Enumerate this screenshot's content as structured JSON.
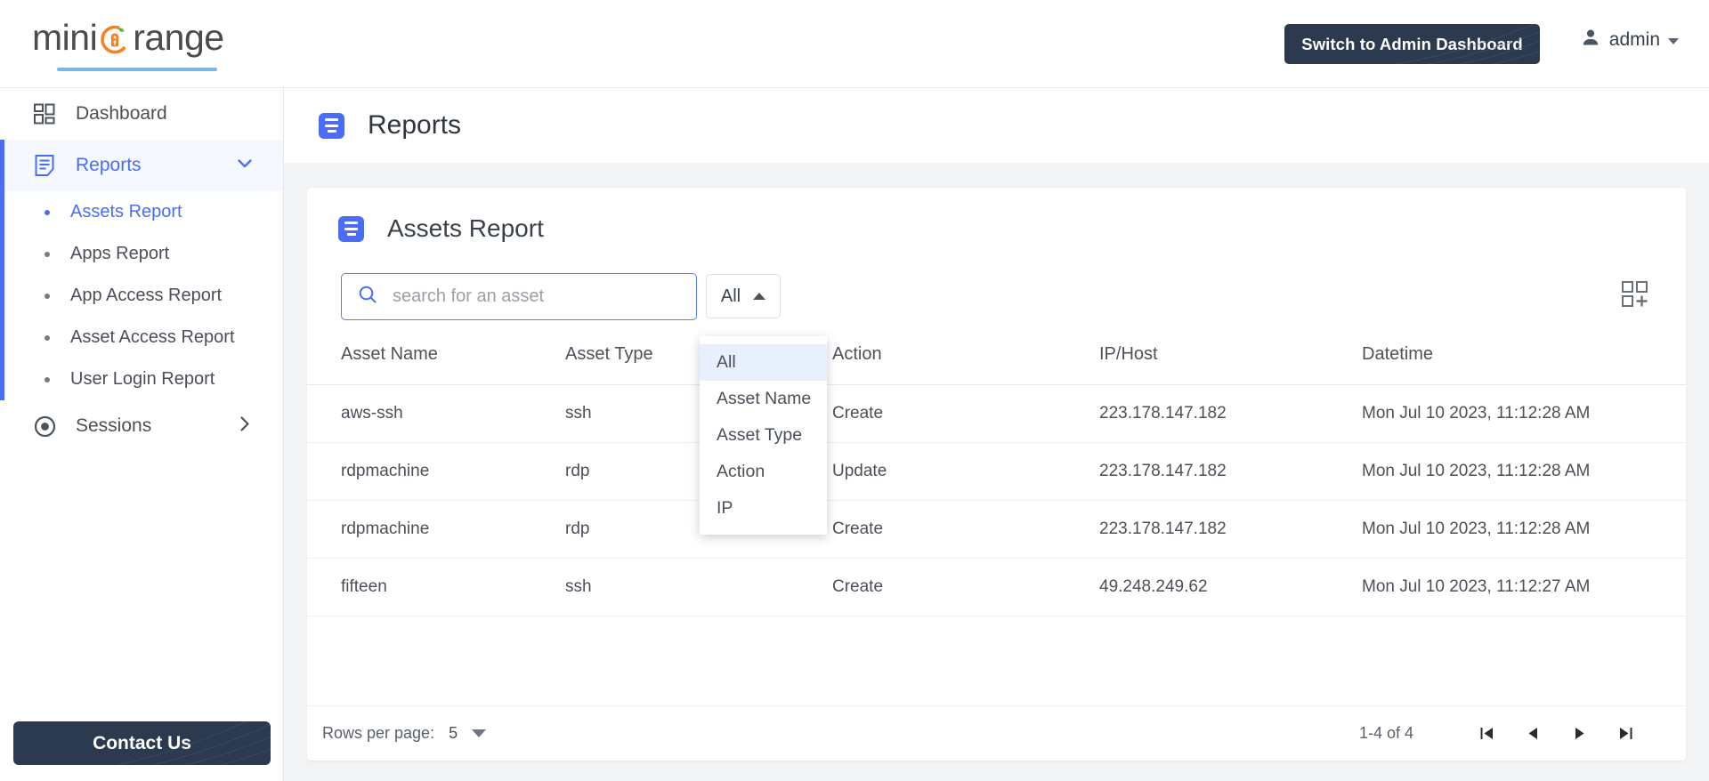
{
  "brand": {
    "logo_prefix": "mini",
    "logo_suffix": "range",
    "logo_icon": "orange-lock-icon"
  },
  "topbar": {
    "switch_admin_label": "Switch to Admin Dashboard",
    "user_name": "admin",
    "user_icon": "person-icon",
    "user_caret_icon": "chevron-down-icon"
  },
  "sidebar": {
    "items": [
      {
        "label": "Dashboard",
        "icon": "grid-dashboard-icon",
        "active": false,
        "expandable": false
      },
      {
        "label": "Reports",
        "icon": "document-lines-icon",
        "active": true,
        "expandable": true,
        "chevron": "chevron-down-icon"
      },
      {
        "label": "Sessions",
        "icon": "record-circle-icon",
        "active": false,
        "expandable": true,
        "chevron": "chevron-right-icon"
      }
    ],
    "sub_items": [
      {
        "label": "Assets Report",
        "selected": true
      },
      {
        "label": "Apps Report",
        "selected": false
      },
      {
        "label": "App Access Report",
        "selected": false
      },
      {
        "label": "Asset Access Report",
        "selected": false
      },
      {
        "label": "User Login Report",
        "selected": false
      }
    ],
    "contact_us_label": "Contact Us"
  },
  "page": {
    "title": "Reports",
    "title_icon": "document-lines-icon"
  },
  "card": {
    "title": "Assets Report",
    "title_icon": "document-lines-icon"
  },
  "toolbar": {
    "search_placeholder": "search for an asset",
    "search_value": "",
    "search_icon": "search-icon",
    "filter_label": "All",
    "filter_caret_icon": "chevron-up-icon",
    "grid_add_icon": "add-column-grid-icon"
  },
  "filter_dropdown": {
    "open": true,
    "selected": "All",
    "options": [
      {
        "label": "All",
        "active": true
      },
      {
        "label": "Asset Name",
        "active": false
      },
      {
        "label": "Asset Type",
        "active": false
      },
      {
        "label": "Action",
        "active": false
      },
      {
        "label": "IP",
        "active": false
      }
    ]
  },
  "table": {
    "columns": [
      "Asset Name",
      "Asset Type",
      "Action",
      "IP/Host",
      "Datetime"
    ],
    "rows": [
      {
        "asset_name": "aws-ssh",
        "asset_type": "ssh",
        "action": "Create",
        "ip_host": "223.178.147.182",
        "datetime": "Mon Jul 10 2023, 11:12:28 AM"
      },
      {
        "asset_name": "rdpmachine",
        "asset_type": "rdp",
        "action": "Update",
        "ip_host": "223.178.147.182",
        "datetime": "Mon Jul 10 2023, 11:12:28 AM"
      },
      {
        "asset_name": "rdpmachine",
        "asset_type": "rdp",
        "action": "Create",
        "ip_host": "223.178.147.182",
        "datetime": "Mon Jul 10 2023, 11:12:28 AM"
      },
      {
        "asset_name": "fifteen",
        "asset_type": "ssh",
        "action": "Create",
        "ip_host": "49.248.249.62",
        "datetime": "Mon Jul 10 2023, 11:12:27 AM"
      }
    ]
  },
  "footer": {
    "rows_per_page_label": "Rows per page:",
    "rows_per_page_value": "5",
    "rows_per_page_caret": "chevron-down-icon",
    "page_count": "1-4 of 4",
    "first_page_icon": "first-page-icon",
    "prev_page_icon": "previous-page-icon",
    "next_page_icon": "next-page-icon",
    "last_page_icon": "last-page-icon"
  },
  "colors": {
    "accent_blue": "#4a6cf7",
    "dark_navy": "#2b3a4f",
    "orange": "#f58220",
    "page_bg": "#f3f4f6",
    "text_dark": "#3a414b",
    "text_muted": "#5a606a"
  }
}
